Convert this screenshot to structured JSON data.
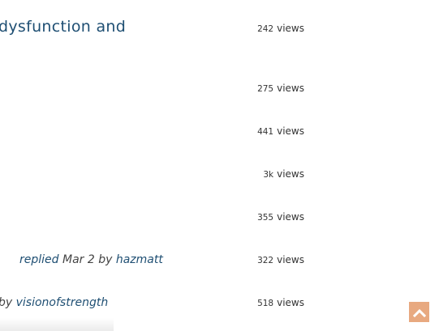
{
  "topics": [
    {
      "title": "dysfunction and",
      "views_count": "242",
      "views_label": "views"
    },
    {
      "views_count": "275",
      "views_label": "views"
    },
    {
      "views_count": "441",
      "views_label": "views"
    },
    {
      "views_count": "3k",
      "views_label": "views"
    },
    {
      "views_count": "355",
      "views_label": "views"
    },
    {
      "views_count": "322",
      "views_label": "views",
      "meta": {
        "action": "replied",
        "date": "Mar 2",
        "by": "by",
        "user": "hazmatt"
      }
    },
    {
      "views_count": "518",
      "views_label": "views",
      "meta": {
        "by": "by",
        "user": "visionofstrength"
      }
    }
  ],
  "back_to_top": {
    "icon": "chevron-up-icon",
    "color": "#e8a980"
  },
  "colors": {
    "link": "#1f4f73",
    "text": "#333333"
  }
}
